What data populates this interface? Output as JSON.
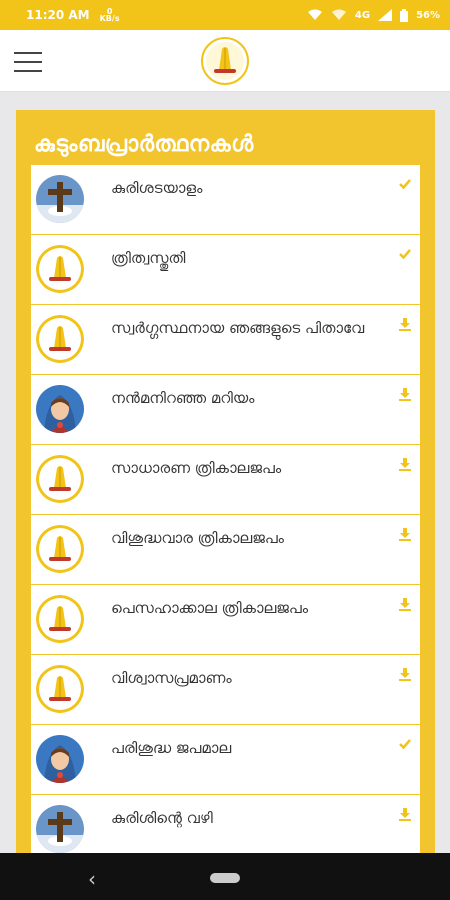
{
  "status_bar": {
    "time": "11:20 AM",
    "speed_value": "0",
    "speed_unit": "KB/s",
    "network": "4G",
    "battery": "56%"
  },
  "header": {
    "menu_icon": "hamburger-menu-icon",
    "logo_icon": "praying-hands-logo"
  },
  "section": {
    "title": "കുടുംബപ്രാർത്ഥനകൾ"
  },
  "prayers": [
    {
      "label": "കുരിശടയാളം",
      "avatar": "cross",
      "status": "check"
    },
    {
      "label": "ത്രിത്വസ്തുതി",
      "avatar": "praying-hands",
      "status": "check"
    },
    {
      "label": "സ്വർഗ്ഗസ്ഥനായ ഞങ്ങളുടെ പിതാവേ",
      "avatar": "praying-hands",
      "status": "download"
    },
    {
      "label": "നൻമനിറഞ്ഞ മറിയം",
      "avatar": "mary",
      "status": "download"
    },
    {
      "label": "സാധാരണ ത്രികാലജപം",
      "avatar": "praying-hands",
      "status": "download"
    },
    {
      "label": "വിശുദ്ധവാര ത്രികാലജപം",
      "avatar": "praying-hands",
      "status": "download"
    },
    {
      "label": "പെസഹാക്കാല ത്രികാലജപം",
      "avatar": "praying-hands",
      "status": "download"
    },
    {
      "label": "വിശ്വാസപ്രമാണം",
      "avatar": "praying-hands",
      "status": "download"
    },
    {
      "label": "പരിശുദ്ധ ജപമാല",
      "avatar": "mary",
      "status": "check"
    },
    {
      "label": "കുരിശിന്റെ വഴി",
      "avatar": "cross",
      "status": "download"
    }
  ],
  "colors": {
    "accent": "#f2c318",
    "card": "#f2c52f",
    "icon": "#f2c318"
  }
}
